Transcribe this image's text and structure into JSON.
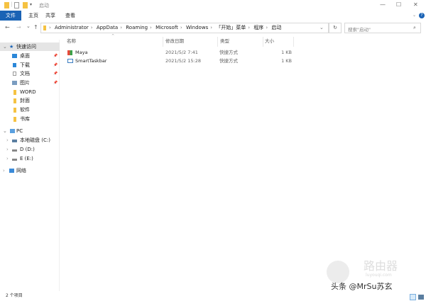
{
  "window": {
    "title": "启动",
    "minimize": "—",
    "maximize": "☐",
    "close": "✕",
    "help": "?"
  },
  "ribbon": {
    "tabs": [
      "文件",
      "主页",
      "共享",
      "查看"
    ]
  },
  "nav": {
    "back": "←",
    "forward": "→",
    "recent": "⌄",
    "up": "↑",
    "refresh": "↻"
  },
  "breadcrumb": [
    "Administrator",
    "AppData",
    "Roaming",
    "Microsoft",
    "Windows",
    "「开始」菜单",
    "程序",
    "启动"
  ],
  "search": {
    "placeholder": "搜索\"启动\""
  },
  "sidebar": {
    "quick_access": "快速访问",
    "quick_items": [
      {
        "label": "桌面",
        "pinned": true
      },
      {
        "label": "下载",
        "pinned": true
      },
      {
        "label": "文档",
        "pinned": true
      },
      {
        "label": "图片",
        "pinned": true
      },
      {
        "label": "WORD"
      },
      {
        "label": "封面"
      },
      {
        "label": "软件"
      },
      {
        "label": "书库"
      }
    ],
    "pc": "PC",
    "drives": [
      "本地磁盘 (C:)",
      "D (D:)",
      "E (E:)"
    ],
    "network": "网络"
  },
  "columns": {
    "name": "名称",
    "date": "修改日期",
    "type": "类型",
    "size": "大小"
  },
  "files": [
    {
      "name": "Maya",
      "date": "2021/5/2 7:41",
      "type": "快捷方式",
      "size": "1 KB"
    },
    {
      "name": "SmartTaskbar",
      "date": "2021/5/2 15:28",
      "type": "快捷方式",
      "size": "1 KB"
    }
  ],
  "status": {
    "count": "2 个项目"
  },
  "watermark": {
    "brand": "路由器",
    "site": "luyouqi.com",
    "credit": "头条 @MrSu苏玄"
  },
  "colors": {
    "accent": "#1a63b5",
    "folder": "#f5c242",
    "selected": "#e5e5e5"
  }
}
